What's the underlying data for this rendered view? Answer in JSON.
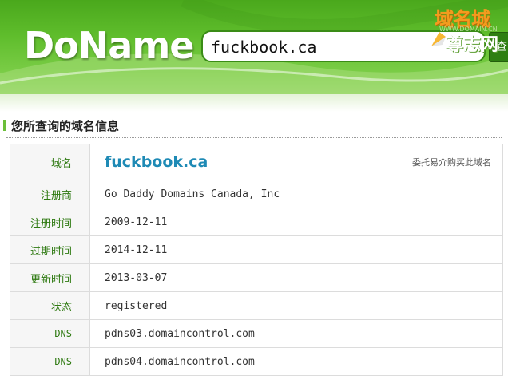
{
  "header": {
    "logo_text": "DoName",
    "search_value": "fuckbook.ca",
    "search_button_glyph": "查",
    "watermark_top": "域名城",
    "watermark_url": "WWW.DOMAIN.CN",
    "watermark_bottom": "尊志网"
  },
  "section": {
    "title": "您所查询的域名信息"
  },
  "table": {
    "domain": {
      "label": "域名",
      "value": "fuckbook.ca",
      "action": "委托易介购买此域名"
    },
    "rows": [
      {
        "label": "注册商",
        "value": "Go Daddy Domains Canada, Inc"
      },
      {
        "label": "注册时间",
        "value": "2009-12-11"
      },
      {
        "label": "过期时间",
        "value": "2014-12-11"
      },
      {
        "label": "更新时间",
        "value": "2013-03-07"
      },
      {
        "label": "状态",
        "value": "registered"
      },
      {
        "label": "DNS",
        "value": "pdns03.domaincontrol.com"
      },
      {
        "label": "DNS",
        "value": "pdns04.domaincontrol.com"
      }
    ]
  },
  "colors": {
    "header_green": "#5fbd2c",
    "label_green": "#2f7a12",
    "domain_blue": "#1e8ab5"
  }
}
